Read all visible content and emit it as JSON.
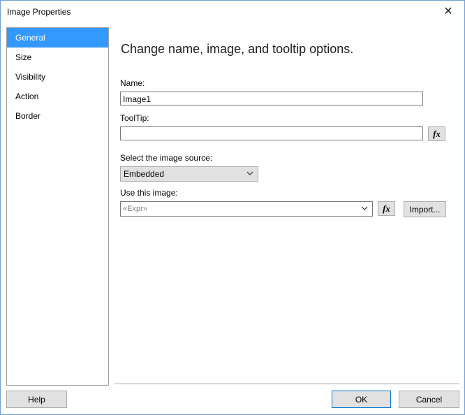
{
  "window": {
    "title": "Image Properties",
    "close_glyph": "✕"
  },
  "sidebar": {
    "items": [
      {
        "label": "General",
        "selected": true
      },
      {
        "label": "Size"
      },
      {
        "label": "Visibility"
      },
      {
        "label": "Action"
      },
      {
        "label": "Border"
      }
    ]
  },
  "main": {
    "heading": "Change name, image, and tooltip options.",
    "name_label": "Name:",
    "name_value": "Image1",
    "tooltip_label": "ToolTip:",
    "tooltip_value": "",
    "fx_label": "fx",
    "source_label": "Select the image source:",
    "source_value": "Embedded",
    "use_image_label": "Use this image:",
    "use_image_value": "«Expr»",
    "import_label": "Import..."
  },
  "footer": {
    "help_label": "Help",
    "ok_label": "OK",
    "cancel_label": "Cancel"
  },
  "colors": {
    "accent": "#3399ff",
    "default_button_border": "#0078d7"
  }
}
